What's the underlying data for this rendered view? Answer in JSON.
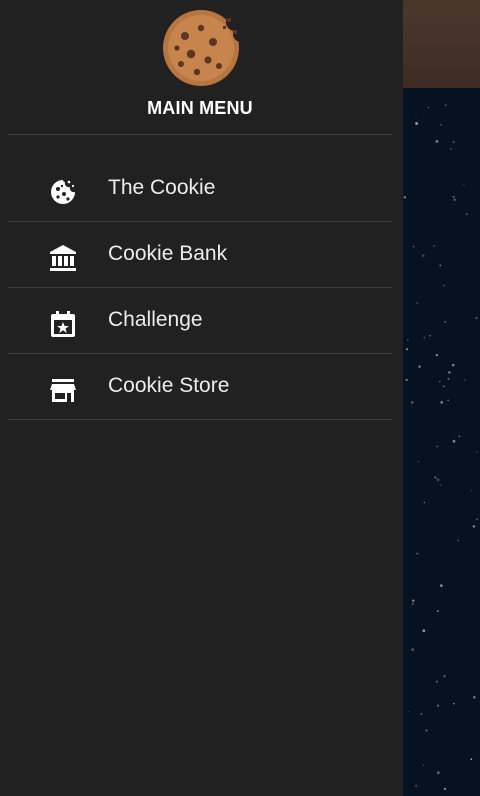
{
  "drawer": {
    "title": "MAIN MENU",
    "logo_icon": "cookie-logo-icon",
    "items": [
      {
        "label": "The Cookie",
        "icon": "cookie-icon"
      },
      {
        "label": "Cookie Bank",
        "icon": "bank-icon"
      },
      {
        "label": "Challenge",
        "icon": "calendar-star-icon"
      },
      {
        "label": "Cookie Store",
        "icon": "store-icon"
      }
    ]
  },
  "colors": {
    "drawer_bg": "#212121",
    "divider": "#3b3b3b",
    "text": "#ececec",
    "background_space": "#06121f",
    "background_header": "#4c372c"
  }
}
